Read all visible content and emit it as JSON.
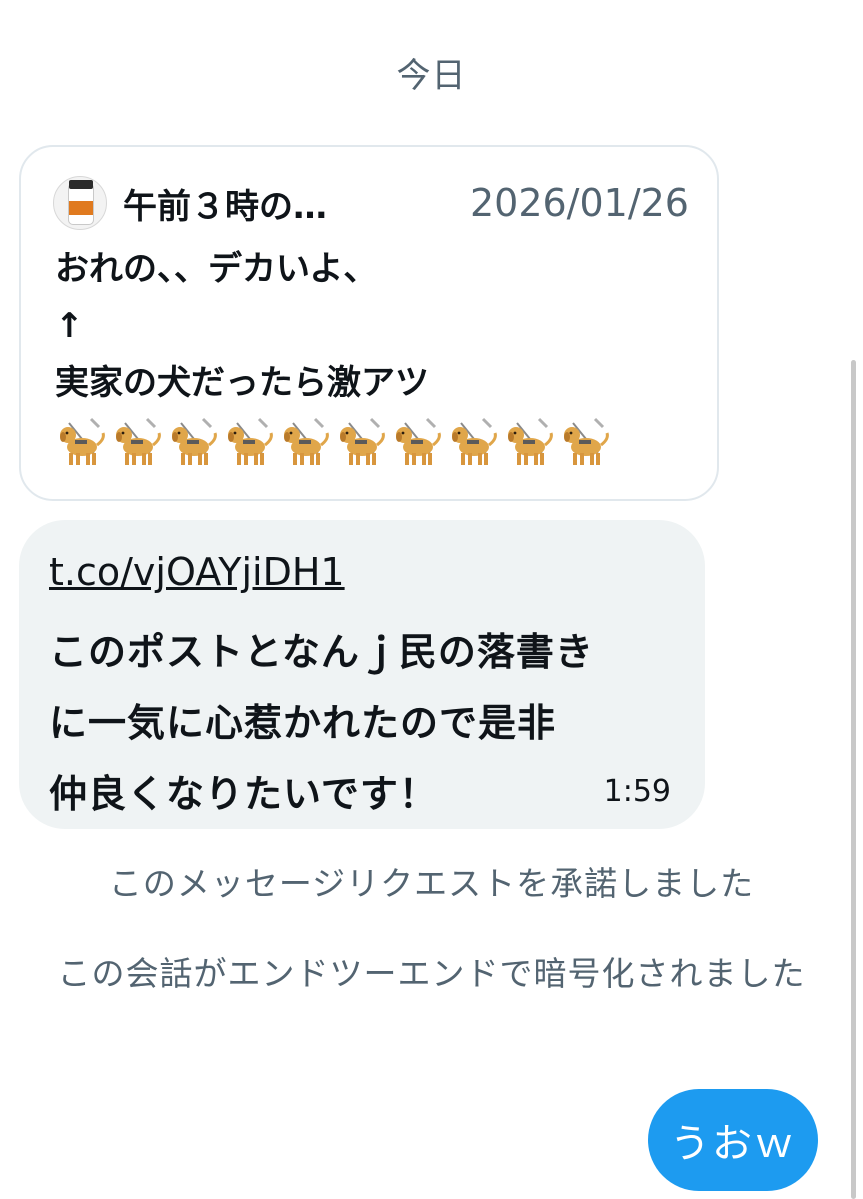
{
  "date_divider": "今日",
  "quote": {
    "author": "午前３時の…",
    "date": "2026/01/26",
    "body": "おれの、、デカいよ、\n↑\n実家の犬だったら激アツ",
    "emoji_icon": "guide-dog-icon",
    "emoji_count": 10
  },
  "incoming": {
    "link": "t.co/vjOAYjiDH1",
    "text": "このポストとなんｊ民の落書き\nに一気に心惹かれたので是非\n仲良くなりたいです！",
    "time": "1:59"
  },
  "notes": {
    "accepted": "このメッセージリクエストを承諾しました",
    "encrypted": "この会話がエンドツーエンドで暗号化されました"
  },
  "outgoing": {
    "text": "うおｗ"
  },
  "colors": {
    "accent": "#1d9bf0",
    "bubble_gray": "#eff3f4",
    "muted_text": "#536471",
    "card_border": "#e1e8ed"
  }
}
